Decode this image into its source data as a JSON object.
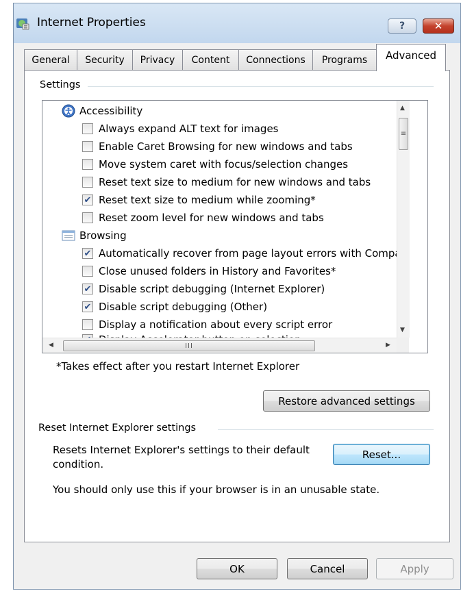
{
  "window": {
    "title": "Internet Properties",
    "help_label": "?",
    "close_label": "✕"
  },
  "tabs": [
    {
      "label": "General"
    },
    {
      "label": "Security"
    },
    {
      "label": "Privacy"
    },
    {
      "label": "Content"
    },
    {
      "label": "Connections"
    },
    {
      "label": "Programs"
    },
    {
      "label": "Advanced",
      "selected": true
    }
  ],
  "settings": {
    "group_label": "Settings",
    "items": [
      {
        "type": "category",
        "icon": "accessibility-icon",
        "label": "Accessibility"
      },
      {
        "type": "checkbox",
        "checked": false,
        "label": "Always expand ALT text for images"
      },
      {
        "type": "checkbox",
        "checked": false,
        "label": "Enable Caret Browsing for new windows and tabs"
      },
      {
        "type": "checkbox",
        "checked": false,
        "label": "Move system caret with focus/selection changes"
      },
      {
        "type": "checkbox",
        "checked": false,
        "label": "Reset text size to medium for new windows and tabs"
      },
      {
        "type": "checkbox",
        "checked": true,
        "label": "Reset text size to medium while zooming*"
      },
      {
        "type": "checkbox",
        "checked": false,
        "label": "Reset zoom level for new windows and tabs"
      },
      {
        "type": "category",
        "icon": "browsing-icon",
        "label": "Browsing"
      },
      {
        "type": "checkbox",
        "checked": true,
        "label": "Automatically recover from page layout errors with Compa"
      },
      {
        "type": "checkbox",
        "checked": false,
        "label": "Close unused folders in History and Favorites*"
      },
      {
        "type": "checkbox",
        "checked": true,
        "label": "Disable script debugging (Internet Explorer)"
      },
      {
        "type": "checkbox",
        "checked": true,
        "label": "Disable script debugging (Other)"
      },
      {
        "type": "checkbox",
        "checked": false,
        "label": "Display a notification about every script error"
      },
      {
        "type": "checkbox",
        "checked": true,
        "label": "Display Accelerator button on selection"
      }
    ],
    "note": "*Takes effect after you restart Internet Explorer",
    "restore_button": "Restore advanced settings"
  },
  "reset": {
    "group_label": "Reset Internet Explorer settings",
    "description_line1": "Resets Internet Explorer's settings to their default",
    "description_line2": "condition.",
    "warning": "You should only use this if your browser is in an unusable state.",
    "reset_button": "Reset..."
  },
  "footer": {
    "ok": "OK",
    "cancel": "Cancel",
    "apply": "Apply"
  },
  "scrollbar": {
    "thumb_grip_v": "≡",
    "thumb_grip_h": "III"
  }
}
